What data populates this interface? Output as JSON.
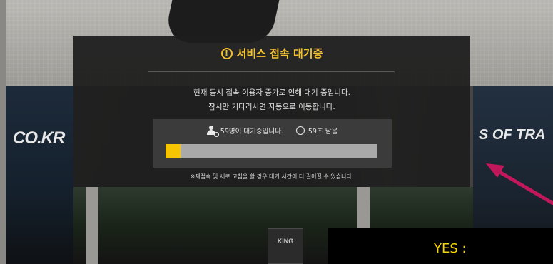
{
  "modal": {
    "title": "서비스 접속 대기중",
    "message_line1": "현재 동시 접속 이용자 증가로 인해 대기 중입니다.",
    "message_line2": "잠시만 기다리시면 자동으로 이동합니다.",
    "queue_status": "59명이 대기중입니다.",
    "time_remaining": "59초 남음",
    "progress_fraction": 0.07,
    "notice": "※재접속 및 새로 고침을 할 경우 대기 시간이 더 길어질 수 있습니다.",
    "accent_color": "#f2c230"
  },
  "background": {
    "left_sign": "CO.KR",
    "right_sign": "S OF TRA",
    "center_badge": "KING"
  },
  "annotation": {
    "label": "YES :",
    "arrow_color": "#c2185b",
    "text_color": "#f6d400"
  }
}
